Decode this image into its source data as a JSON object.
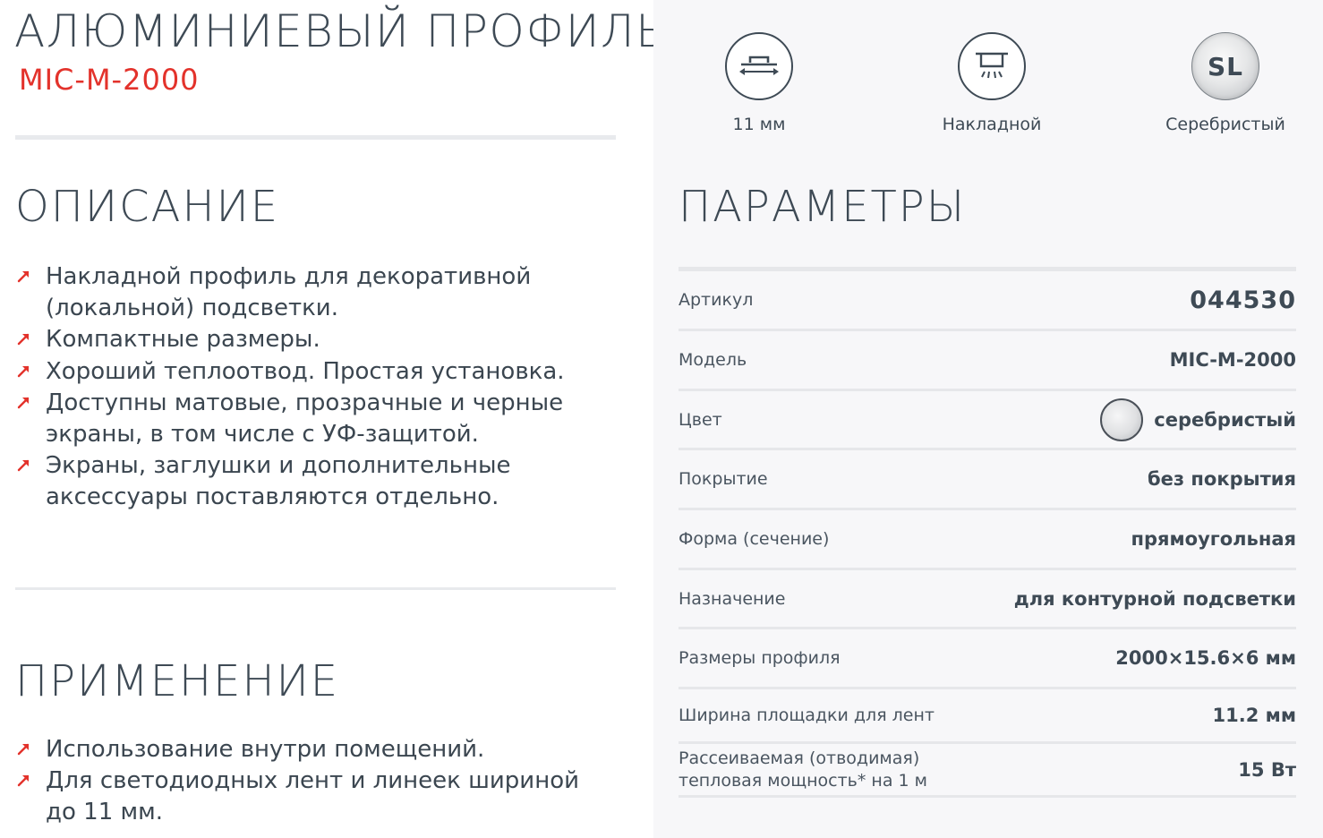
{
  "header": {
    "title": "АЛЮМИНИЕВЫЙ ПРОФИЛЬ",
    "model": "MIC-M-2000"
  },
  "description": {
    "heading": "ОПИСАНИЕ",
    "items": [
      "Накладной профиль для декоративной (локальной) подсветки.",
      "Компактные размеры.",
      "Хороший теплоотвод. Простая установка.",
      "Доступны матовые, прозрачные и черные экраны, в том числе с УФ-защитой.",
      "Экраны, заглушки и дополнительные аксессуары поставляются отдельно."
    ]
  },
  "application": {
    "heading": "ПРИМЕНЕНИЕ",
    "items": [
      "Использование внутри помещений.",
      "Для светодиодных лент и линеек шириной до 11 мм."
    ]
  },
  "features": [
    {
      "icon": "width-icon",
      "label": "11 мм"
    },
    {
      "icon": "surface-mount-icon",
      "label": "Накладной"
    },
    {
      "icon": "silver-color-icon",
      "code": "SL",
      "label": "Серебристый"
    }
  ],
  "parameters": {
    "heading": "ПАРАМЕТРЫ",
    "rows": [
      {
        "label": "Артикул",
        "value": "044530"
      },
      {
        "label": "Модель",
        "value": "MIC-M-2000"
      },
      {
        "label": "Цвет",
        "value": "серебристый"
      },
      {
        "label": "Покрытие",
        "value": "без покрытия"
      },
      {
        "label": "Форма (сечение)",
        "value": "прямоугольная"
      },
      {
        "label": "Назначение",
        "value": "для контурной подсветки"
      },
      {
        "label": "Размеры профиля",
        "value": "2000×15.6×6 мм"
      },
      {
        "label": "Ширина площадки для лент",
        "value": "11.2 мм"
      },
      {
        "label_line1": "Рассеиваемая (отводимая)",
        "label_line2": "тепловая мощность* на 1 м",
        "value": "15 Вт"
      }
    ]
  },
  "colors": {
    "accent": "#e3322b",
    "text": "#3e4a55",
    "panel": "#f7f7f9"
  }
}
